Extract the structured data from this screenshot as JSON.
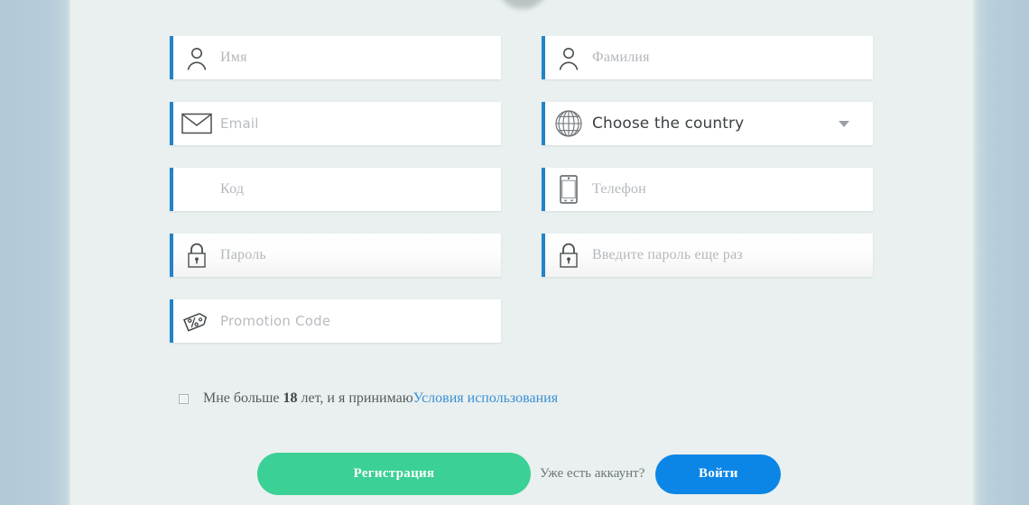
{
  "page": {
    "background_outer": "#b4cbd9",
    "background_card": "#e9f0ef",
    "accent_bar_color": "#2283c9"
  },
  "form": {
    "rows": [
      {
        "left": {
          "name": "first-name",
          "placeholder": "Имя",
          "icon": "person-icon",
          "font": "serif",
          "shaded": false
        },
        "right": {
          "name": "last-name",
          "placeholder": "Фамилия",
          "icon": "person-icon",
          "font": "serif",
          "shaded": false
        }
      },
      {
        "left": {
          "name": "email",
          "placeholder": "Email",
          "icon": "envelope-icon",
          "font": "sans",
          "shaded": false
        },
        "right": {
          "name": "country-select",
          "value": "Choose the country",
          "icon": "globe-icon",
          "type": "select"
        }
      },
      {
        "left": {
          "name": "code",
          "placeholder": "Код",
          "icon": "none",
          "font": "serif",
          "shaded": false
        },
        "right": {
          "name": "phone",
          "placeholder": "Телефон",
          "icon": "smartphone-icon",
          "font": "serif",
          "shaded": false
        }
      },
      {
        "left": {
          "name": "password",
          "placeholder": "Пароль",
          "icon": "lock-icon",
          "font": "serif",
          "shaded": true
        },
        "right": {
          "name": "password-confirm",
          "placeholder": "Введите пароль еще раз",
          "icon": "lock-icon",
          "font": "serif",
          "shaded": true
        }
      },
      {
        "left": {
          "name": "promo-code",
          "placeholder": "Promotion Code",
          "icon": "price-tag-icon",
          "font": "sans",
          "shaded": false
        },
        "right": null
      }
    ]
  },
  "terms": {
    "checked": false,
    "text_before_age": "Мне больше ",
    "age": "18",
    "text_after_age": " лет, и я принимаю",
    "link_label": "Условия использования"
  },
  "actions": {
    "register_label": "Регистрация",
    "register_color": "#3bd095",
    "have_account_label": "Уже есть аккаунт?",
    "login_label": "Войти",
    "login_color": "#0b86e6"
  }
}
